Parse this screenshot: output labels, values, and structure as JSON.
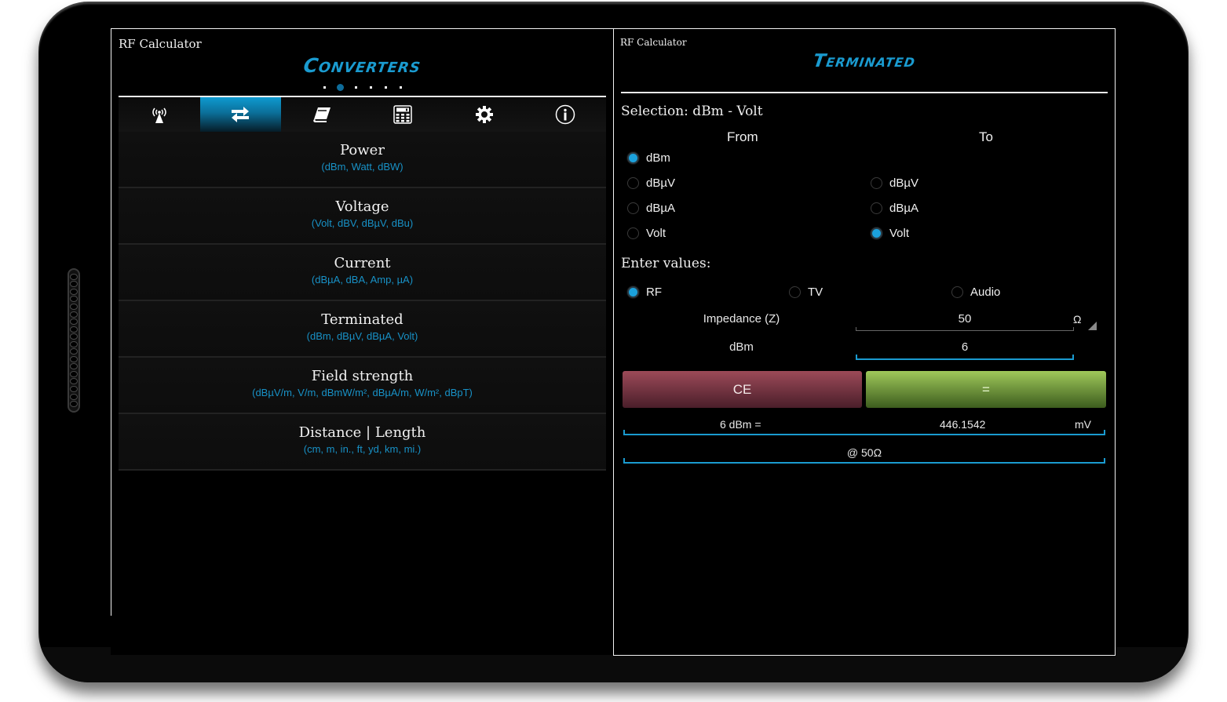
{
  "app_title": "RF Calculator",
  "left_panel": {
    "section_title": "Converters",
    "pager": {
      "total": 6,
      "active_index": 1
    },
    "tabs": [
      {
        "name": "wireless",
        "icon": "antenna-signal-icon"
      },
      {
        "name": "converters",
        "icon": "swap-arrows-icon",
        "active": true
      },
      {
        "name": "reference",
        "icon": "book-icon"
      },
      {
        "name": "calculator",
        "icon": "calculator-icon"
      },
      {
        "name": "settings",
        "icon": "gear-icon"
      },
      {
        "name": "about",
        "icon": "info-icon"
      }
    ],
    "converters": [
      {
        "title": "Power",
        "units": "(dBm, Watt, dBW)"
      },
      {
        "title": "Voltage",
        "units": "(Volt, dBV, dBµV, dBu)"
      },
      {
        "title": "Current",
        "units": "(dBµA, dBA, Amp, µA)"
      },
      {
        "title": "Terminated",
        "units": "(dBm, dBµV, dBµA, Volt)"
      },
      {
        "title": "Field strength",
        "units": "(dBµV/m, V/m, dBmW/m², dBµA/m, W/m², dBpT)"
      },
      {
        "title": "Distance | Length",
        "units": "(cm, m, in., ft, yd, km, mi.)"
      }
    ]
  },
  "right_panel": {
    "section_title": "Terminated",
    "selection_label": "Selection: dBm - Volt",
    "from_header": "From",
    "to_header": "To",
    "from_options": [
      {
        "label": "dBm",
        "checked": true
      },
      {
        "label": "dBµV",
        "checked": false
      },
      {
        "label": "dBµA",
        "checked": false
      },
      {
        "label": "Volt",
        "checked": false
      }
    ],
    "to_options": [
      {
        "label": "dBµV",
        "checked": false
      },
      {
        "label": "dBµA",
        "checked": false
      },
      {
        "label": "Volt",
        "checked": true
      }
    ],
    "enter_values_label": "Enter values:",
    "mode_options": [
      {
        "label": "RF",
        "checked": true
      },
      {
        "label": "TV",
        "checked": false
      },
      {
        "label": "Audio",
        "checked": false
      }
    ],
    "impedance_label": "Impedance (Z)",
    "impedance_value": "50",
    "impedance_unit": "Ω",
    "input_label": "dBm",
    "input_value": "6",
    "ce_button": "CE",
    "equals_button": "=",
    "result": {
      "expression": "6 dBm =",
      "value": "446.1542",
      "unit": "mV",
      "impedance_note": "@ 50Ω"
    }
  },
  "colors": {
    "accent": "#1a9bd0",
    "ce_button": "#9c4a58",
    "equals_button": "#9fc85a"
  }
}
